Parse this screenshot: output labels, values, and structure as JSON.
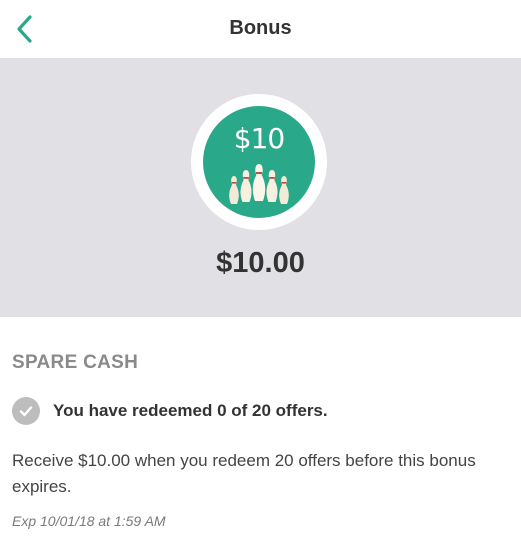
{
  "header": {
    "title": "Bonus",
    "back_icon": "chevron-left-icon",
    "accent_color": "#2aa98a"
  },
  "hero": {
    "badge_label": "$10",
    "badge_image": "bowling-pins-icon",
    "badge_color": "#2aa98a",
    "amount": "$10.00",
    "background_color": "#e1e0e5"
  },
  "bonus": {
    "section_title": "SPARE CASH",
    "status_icon": "check-circle-icon",
    "progress_text": "You have redeemed 0 of 20 offers.",
    "offers_redeemed": 0,
    "offers_required": 20,
    "description": "Receive $10.00 when you redeem 20 offers before this bonus expires.",
    "expiry": "Exp 10/01/18 at 1:59 AM"
  }
}
